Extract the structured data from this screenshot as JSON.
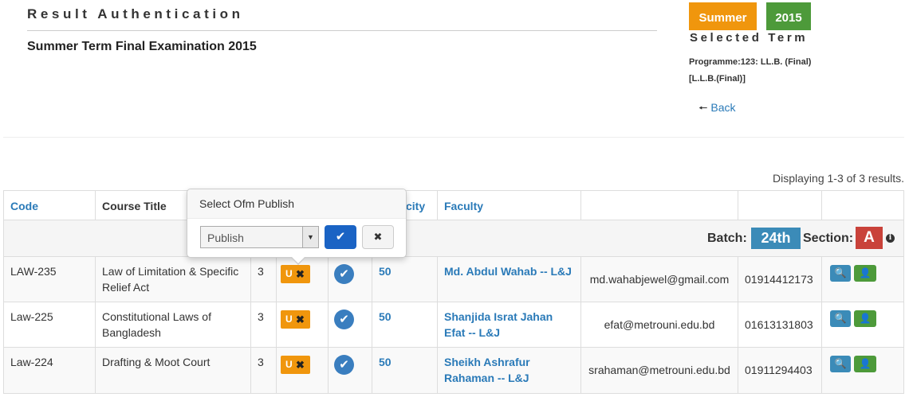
{
  "header": {
    "title": "Result Authentication",
    "subtitle": "Summer Term Final Examination 2015"
  },
  "term": {
    "season": "Summer",
    "year": "2015",
    "label": "Selected Term",
    "programme_line1": "Programme:123: LL.B. (Final)",
    "programme_line2": "[L.L.B.(Final)]",
    "back_label": "Back"
  },
  "summary": "Displaying 1-3 of 3 results.",
  "table": {
    "headers": {
      "code": "Code",
      "course_title": "Course Title",
      "capacity_partial": "city",
      "faculty": "Faculty"
    },
    "batch_label": "Batch:",
    "batch_value": "24th",
    "section_label": "Section:",
    "section_value": "A",
    "rows": [
      {
        "code": "LAW-235",
        "title": "Law of Limitation & Specific Relief Act",
        "credit": "3",
        "status": "U",
        "capacity": "50",
        "faculty": "Md. Abdul Wahab -- L&J",
        "email": "md.wahabjewel@gmail.com",
        "phone": "01914412173"
      },
      {
        "code": "Law-225",
        "title": "Constitutional Laws of Bangladesh",
        "credit": "3",
        "status": "U",
        "capacity": "50",
        "faculty": "Shanjida Israt Jahan Efat -- L&J",
        "email": "efat@metrouni.edu.bd",
        "phone": "01613131803"
      },
      {
        "code": "Law-224",
        "title": "Drafting & Moot Court",
        "credit": "3",
        "status": "U",
        "capacity": "50",
        "faculty": "Sheikh Ashrafur Rahaman -- L&J",
        "email": "srahaman@metrouni.edu.bd",
        "phone": "01911294403"
      }
    ]
  },
  "popover": {
    "title": "Select Ofm Publish",
    "selected": "Publish"
  },
  "icons": {
    "back": "arrow-left-icon",
    "check": "check-icon",
    "close": "close-icon",
    "search": "search-icon",
    "user": "user-icon",
    "info": "info-icon"
  },
  "colors": {
    "summer": "#f0960d",
    "year": "#4d9a3a",
    "batch": "#3b8bb8",
    "section": "#c9423a",
    "link": "#2a7ab8",
    "primary_button": "#1a63c4"
  }
}
